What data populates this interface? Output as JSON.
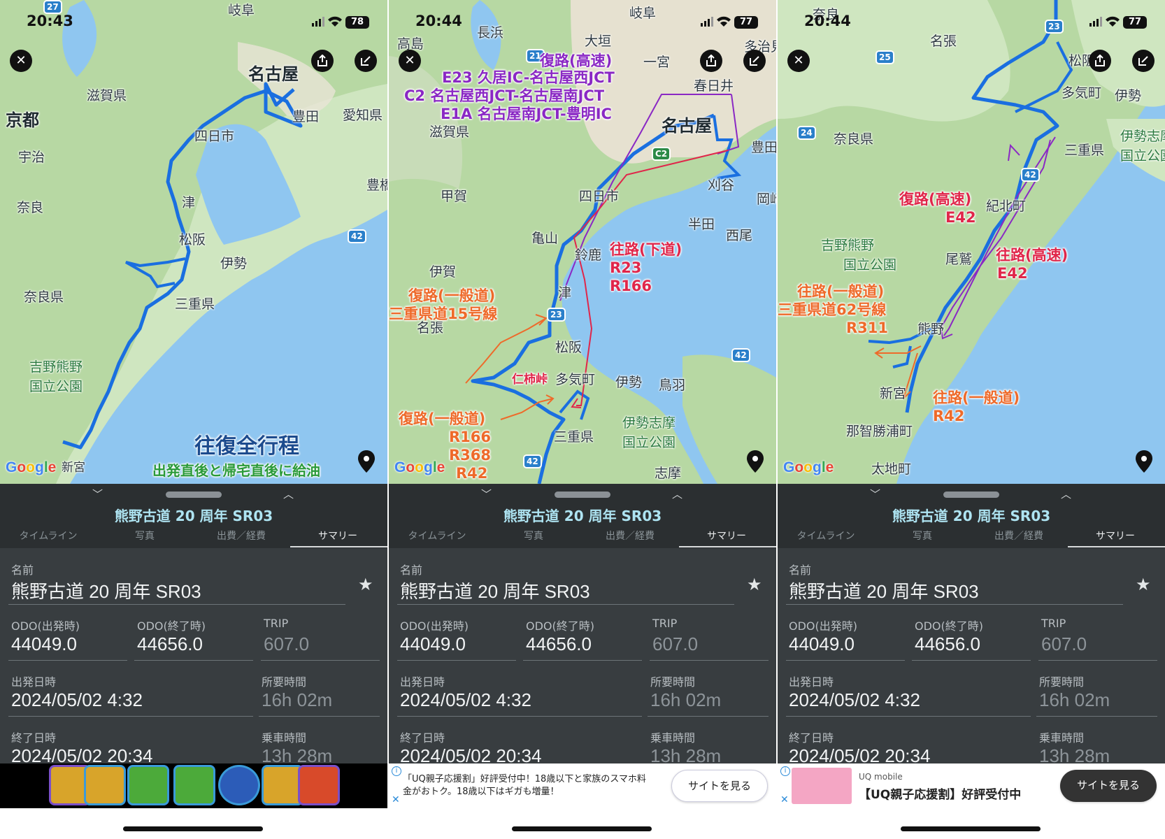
{
  "screens": [
    {
      "status": {
        "time": "20:43",
        "battery": "78"
      },
      "places": [
        "岐阜",
        "名古屋",
        "滋賀県",
        "京都",
        "豊田",
        "愛知県",
        "四日市",
        "宇治",
        "奈良",
        "津",
        "豊橋",
        "松阪",
        "伊勢",
        "奈良県",
        "三重県",
        "吉野熊野",
        "国立公園",
        "新宮"
      ],
      "shields": [
        "27",
        "42"
      ],
      "annotations": {
        "title": "往復全行程",
        "subtitle": "出発直後と帰宅直後に給油"
      }
    },
    {
      "status": {
        "time": "20:44",
        "battery": "77"
      },
      "places": [
        "高島",
        "長浜",
        "岐阜",
        "大垣",
        "一宮",
        "多治見",
        "春日井",
        "滋賀県",
        "名古屋",
        "豊田",
        "刈谷",
        "甲賀",
        "四日市",
        "岡崎",
        "半田",
        "亀山",
        "鈴鹿",
        "西尾",
        "伊賀",
        "津",
        "名張",
        "松阪",
        "多気町",
        "伊勢",
        "鳥羽",
        "三重県",
        "伊勢志摩",
        "国立公園",
        "志摩"
      ],
      "shields": [
        "21",
        "C2",
        "23",
        "42",
        "42"
      ],
      "annotations": {
        "return_highway": [
          "復路(高速)",
          "E23 久居IC-名古屋西JCT",
          "C2 名古屋西JCT-名古屋南JCT",
          "E1A 名古屋南JCT-豊明IC"
        ],
        "outbound_road": [
          "往路(下道)",
          "R23",
          "R166"
        ],
        "return_general1": [
          "復路(一般道)",
          "三重県道15号線"
        ],
        "pass": "仁柿峠",
        "return_general2": [
          "復路(一般道)",
          "R166",
          "R368",
          "R42"
        ]
      }
    },
    {
      "status": {
        "time": "20:44",
        "battery": "77"
      },
      "places": [
        "奈良",
        "名張",
        "松阪",
        "多気町",
        "伊勢",
        "奈良県",
        "三重県",
        "伊勢志摩",
        "国立公園",
        "紀北町",
        "吉野熊野",
        "国立公園",
        "尾鷲",
        "熊野",
        "新宮",
        "那智勝浦町",
        "太地町"
      ],
      "shields": [
        "23",
        "25",
        "24",
        "42"
      ],
      "annotations": {
        "return_highway": [
          "復路(高速)",
          "E42"
        ],
        "outbound_highway": [
          "往路(高速)",
          "E42"
        ],
        "outbound_general": [
          "往路(一般道)",
          "三重県道62号線",
          "R311"
        ],
        "outbound_r42": [
          "往路(一般道)",
          "R42"
        ]
      }
    }
  ],
  "sheet": {
    "title": "熊野古道 20 周年 SR03",
    "tabs": [
      "タイムライン",
      "写真",
      "出費／経費",
      "サマリー"
    ],
    "active_tab": "サマリー",
    "name_label": "名前",
    "name_value": "熊野古道 20 周年 SR03",
    "odo_start_label": "ODO(出発時)",
    "odo_start_value": "44049.0",
    "odo_end_label": "ODO(終了時)",
    "odo_end_value": "44656.0",
    "trip_label": "TRIP",
    "trip_value": "607.0",
    "depart_label": "出発日時",
    "depart_value": "2024/05/02 4:32",
    "duration_label": "所要時間",
    "duration_value": "16h 02m",
    "end_label": "終了日時",
    "end_value": "2024/05/02 20:34",
    "ride_label": "乗車時間",
    "ride_value": "13h 28m"
  },
  "ads": {
    "ad2_text": "「UQ親子応援割」好評受付中！18歳以下と家族のスマホ料金がおトク。18歳以下はギガも増量！",
    "ad2_button": "サイトを見る",
    "ad3_small": "UQ mobile",
    "ad3_headline": "【UQ親子応援割】好評受付中",
    "ad3_button": "サイトを見る"
  },
  "map_brand": "Google",
  "colors": {
    "route": "#1a6fe0",
    "purple": "#8a28c4",
    "red": "#e0264a",
    "orange": "#ee6a2a",
    "sheet_bg": "#383d40"
  }
}
